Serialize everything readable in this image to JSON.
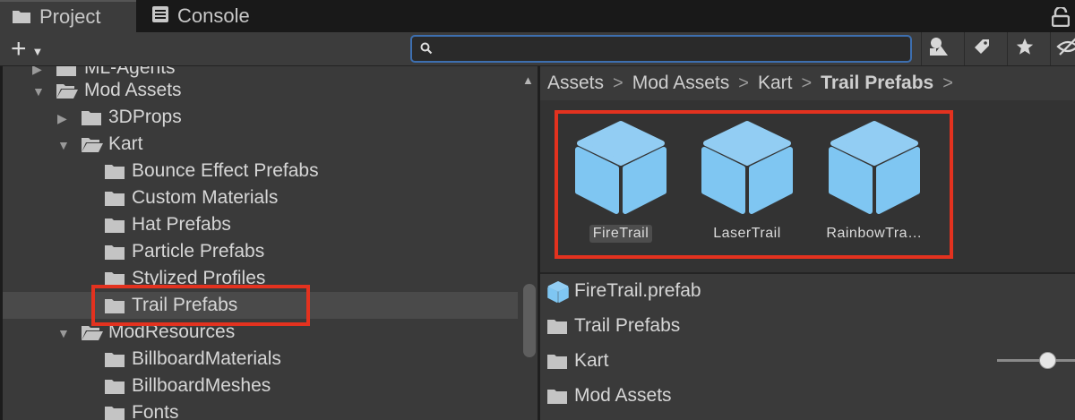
{
  "tabs": [
    {
      "label": "Project",
      "icon": "folder-icon"
    },
    {
      "label": "Console",
      "icon": "console-icon"
    }
  ],
  "toolbar": {
    "add_label": "+",
    "search_value": "",
    "search_placeholder": ""
  },
  "tree": [
    {
      "label": "ML-Agents",
      "expanded": false
    },
    {
      "label": "Mod Assets",
      "expanded": true
    },
    {
      "label": "3DProps",
      "expanded": false
    },
    {
      "label": "Kart",
      "expanded": true
    },
    {
      "label": "Bounce Effect Prefabs"
    },
    {
      "label": "Custom Materials"
    },
    {
      "label": "Hat Prefabs"
    },
    {
      "label": "Particle Prefabs"
    },
    {
      "label": "Stylized Profiles"
    },
    {
      "label": "Trail Prefabs",
      "selected": true
    },
    {
      "label": "ModResources",
      "expanded": true
    },
    {
      "label": "BillboardMaterials"
    },
    {
      "label": "BillboardMeshes"
    },
    {
      "label": "Fonts"
    }
  ],
  "breadcrumb": {
    "items": [
      "Assets",
      "Mod Assets",
      "Kart"
    ],
    "current": "Trail Prefabs",
    "separator": ">"
  },
  "assets": [
    {
      "name": "FireTrail",
      "selected": true
    },
    {
      "name": "LaserTrail",
      "selected": false
    },
    {
      "name": "RainbowTra…",
      "selected": false
    }
  ],
  "list": [
    {
      "label": "FireTrail.prefab",
      "icon": "prefab-icon"
    },
    {
      "label": "Trail Prefabs",
      "icon": "folder-icon"
    },
    {
      "label": "Kart",
      "icon": "folder-icon"
    },
    {
      "label": "Mod Assets",
      "icon": "folder-icon"
    }
  ],
  "colors": {
    "accent": "#3d6fb0",
    "highlight": "#e3321f",
    "cube": "#7fc6f2"
  }
}
